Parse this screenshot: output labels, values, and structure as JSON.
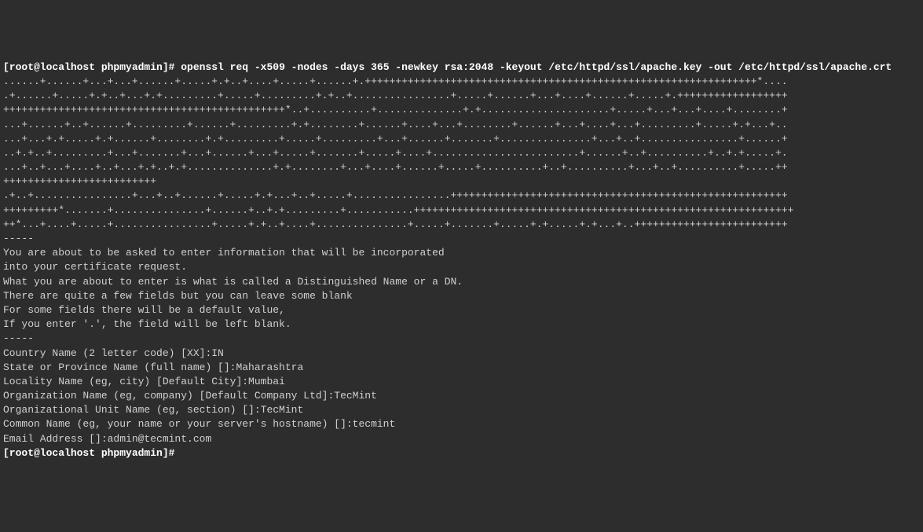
{
  "terminal": {
    "prompt1": {
      "user_host": "[root@localhost ",
      "path": "phpmyadmin",
      "bracket": "]# ",
      "command": "openssl req -x509 -nodes -days 365 -newkey rsa:2048 -keyout /etc/httpd/ssl/apache.key -out /etc/httpd/ssl/apache.crt"
    },
    "keygen": {
      "line1": "......+......+...+...+......+.....+.+..+....+.....+......+.++++++++++++++++++++++++++++++++++++++++++++++++++++++++++++++++*....",
      "line2": ".+......+.....+.+..+...+.+.........+.....+.........+.+..+................+.....+......+...+....+......+.....+.++++++++++++++++++",
      "line3": "++++++++++++++++++++++++++++++++++++++++++++++*..+..........+..............+.+.....................+.....+...+...+....+........+",
      "line4": "...+......+..+......+.........+......+.........+.+........+......+....+...+........+......+...+....+...+.........+.....+.+...+..",
      "line5": "...+...+.+.....+.+......+........+.+.........+.....+.........+...+......+.......+...............+...+..+................+......+",
      "line6": "..+.+..+.........+...+.......+...+......+...+.....+.......+.....+....+........................+......+..+..........+..+.+.....+.",
      "line7": "...+..+...+....+..+...+.+..+.+..............+.+........+...+....+......+.....+..........+..+..........+...+..+..........+.....++",
      "line8": "+++++++++++++++++++++++++",
      "line9": ".+..+................+...+..+......+.....+.+...+..+.....+................+++++++++++++++++++++++++++++++++++++++++++++++++++++++",
      "line10": "+++++++++*.......+...............+......+..+.+.........+...........++++++++++++++++++++++++++++++++++++++++++++++++++++++++++++++",
      "line11": "++*...+....+.....+................+.....+.+..+....+...............+.....+.......+.....+.+.....+.+...+..+++++++++++++++++++++++++",
      "line12": "-----"
    },
    "info": {
      "line1": "You are about to be asked to enter information that will be incorporated",
      "line2": "into your certificate request.",
      "line3": "What you are about to enter is what is called a Distinguished Name or a DN.",
      "line4": "There are quite a few fields but you can leave some blank",
      "line5": "For some fields there will be a default value,",
      "line6": "If you enter '.', the field will be left blank.",
      "line7": "-----"
    },
    "fields": {
      "country": "Country Name (2 letter code) [XX]:IN",
      "state": "State or Province Name (full name) []:Maharashtra",
      "locality": "Locality Name (eg, city) [Default City]:Mumbai",
      "org": "Organization Name (eg, company) [Default Company Ltd]:TecMint",
      "orgunit": "Organizational Unit Name (eg, section) []:TecMint",
      "common": "Common Name (eg, your name or your server's hostname) []:tecmint",
      "email": "Email Address []:admin@tecmint.com"
    },
    "prompt2": {
      "user_host": "[root@localhost ",
      "path": "phpmyadmin",
      "bracket": "]# "
    }
  }
}
